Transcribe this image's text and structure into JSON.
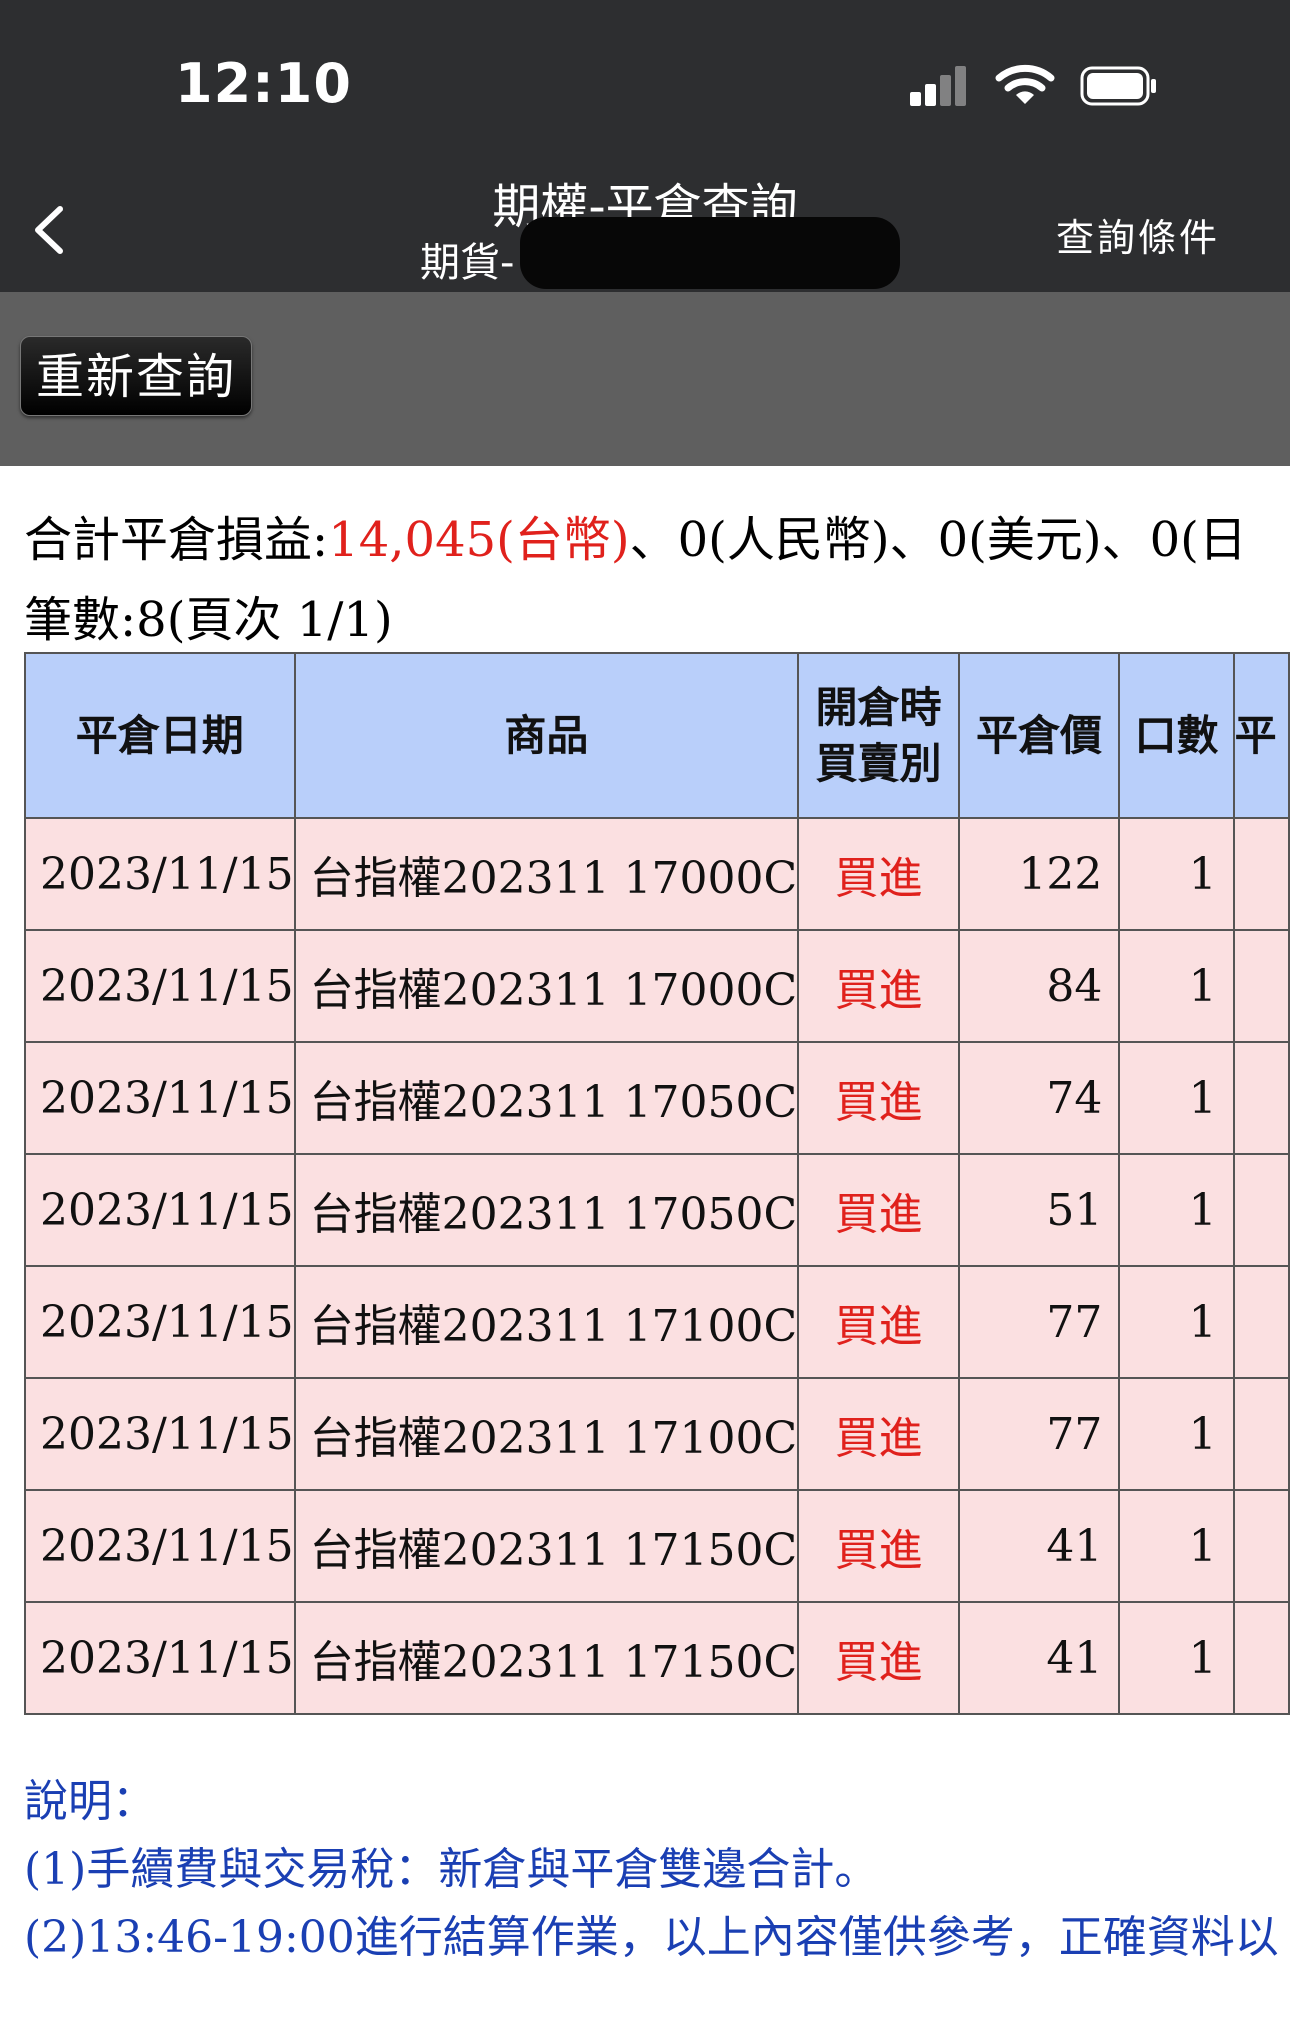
{
  "status_bar": {
    "time": "12:10"
  },
  "nav": {
    "title": "期權-平倉查詢",
    "subtitle": "期貨-",
    "query_conditions": "查詢條件"
  },
  "toolbar": {
    "requery_label": "重新查詢"
  },
  "summary": {
    "label": "合計平倉損益:",
    "twd": "14,045(台幣)",
    "rest": "、0(人民幣)、0(美元)、0(日",
    "count": "筆數:8(頁次 1/1)"
  },
  "table": {
    "headers": [
      "平倉日期",
      "商品",
      "開倉時\n買賣別",
      "平倉價",
      "口數",
      "平"
    ],
    "rows": [
      {
        "date": "2023/11/15",
        "product": "台指權202311 17000C",
        "side": "買進",
        "price": "122",
        "qty": "1"
      },
      {
        "date": "2023/11/15",
        "product": "台指權202311 17000C",
        "side": "買進",
        "price": "84",
        "qty": "1"
      },
      {
        "date": "2023/11/15",
        "product": "台指權202311 17050C",
        "side": "買進",
        "price": "74",
        "qty": "1"
      },
      {
        "date": "2023/11/15",
        "product": "台指權202311 17050C",
        "side": "買進",
        "price": "51",
        "qty": "1"
      },
      {
        "date": "2023/11/15",
        "product": "台指權202311 17100C",
        "side": "買進",
        "price": "77",
        "qty": "1"
      },
      {
        "date": "2023/11/15",
        "product": "台指權202311 17100C",
        "side": "買進",
        "price": "77",
        "qty": "1"
      },
      {
        "date": "2023/11/15",
        "product": "台指權202311 17150C",
        "side": "買進",
        "price": "41",
        "qty": "1"
      },
      {
        "date": "2023/11/15",
        "product": "台指權202311 17150C",
        "side": "買進",
        "price": "41",
        "qty": "1"
      }
    ]
  },
  "notes": {
    "title": "說明：",
    "items": [
      "(1)手續費與交易稅：新倉與平倉雙邊合計。",
      "(2)13:46-19:00進行結算作業，以上內容僅供參考，正確資料以"
    ]
  },
  "colors": {
    "header_bg": "#2d2e30",
    "toolbar_bg": "#5f5f5f",
    "table_header_bg": "#b9cffa",
    "table_row_bg": "#fbe0e1",
    "accent_red": "#e0211c",
    "note_blue": "#1a3fb3"
  }
}
